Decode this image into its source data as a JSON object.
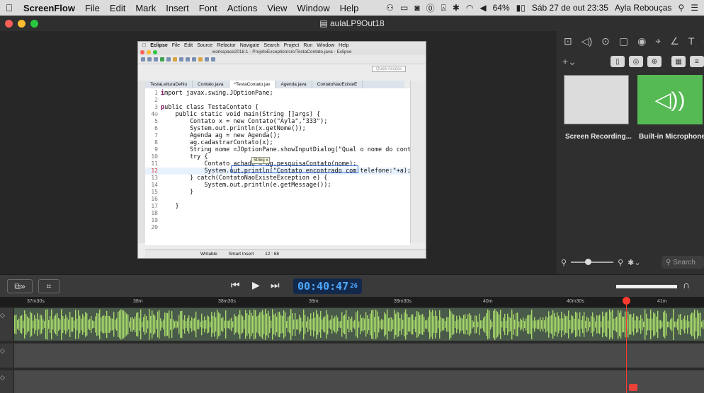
{
  "menubar": {
    "apple": "",
    "app": "ScreenFlow",
    "items": [
      "File",
      "Edit",
      "Mark",
      "Insert",
      "Font",
      "Actions",
      "View",
      "Window",
      "Help"
    ],
    "battery": "64%",
    "clock": "Sáb 27 de out  23:35",
    "user": "Ayla Rebouças"
  },
  "window": {
    "title": "aulaLP9Out18"
  },
  "eclipse": {
    "menu": [
      "Eclipse",
      "File",
      "Edit",
      "Source",
      "Refactor",
      "Navigate",
      "Search",
      "Project",
      "Run",
      "Window",
      "Help"
    ],
    "title": "workspace2018.1 - ProjetoException/src/TestaContato.java - Eclipse",
    "quick_access": "Quick Access",
    "tabs": [
      "TestaLeituraDeNu",
      "Contato.java",
      "*TestaContato.jav",
      "Agenda.java",
      "ContatoNaoExisteE"
    ],
    "active_tab": 2,
    "tooltip": "String x",
    "status": {
      "mode": "Writable",
      "insert": "Smart Insert",
      "pos": "12 : 68"
    },
    "code": [
      {
        "n": "1",
        "text": "mport javax.swing.JOptionPane;"
      },
      {
        "n": "2",
        "text": ""
      },
      {
        "n": "3",
        "text": "ublic class TestaContato {"
      },
      {
        "n": "4⊖",
        "text": "    public static void main(String []args) {"
      },
      {
        "n": "5",
        "text": "        Contato x = new Contato(\"Ayla\",\"333\");"
      },
      {
        "n": "6",
        "text": "        System.out.println(x.getNome());"
      },
      {
        "n": "7",
        "text": "        Agenda ag = new Agenda();"
      },
      {
        "n": "8",
        "text": "        ag.cadastrarContato(x);"
      },
      {
        "n": "9",
        "text": "        String nome =JOptionPane.showInputDialog(\"Qual o nome do contat"
      },
      {
        "n": "10",
        "text": "        try {"
      },
      {
        "n": "11",
        "text": "            Contato achado = ag.pesquisaContato(nome);"
      },
      {
        "n": "12",
        "text": "            System.out.println(\"Contato encontrado com telefone:\"+a);"
      },
      {
        "n": "13",
        "text": "        } catch(ContatoNaoExisteException e) {"
      },
      {
        "n": "14",
        "text": "            System.out.println(e.getMessage());"
      },
      {
        "n": "15",
        "text": "        }"
      },
      {
        "n": "16",
        "text": ""
      },
      {
        "n": "17",
        "text": "    }"
      },
      {
        "n": "18",
        "text": ""
      },
      {
        "n": "19",
        "text": ""
      },
      {
        "n": "20",
        "text": ""
      }
    ]
  },
  "media": {
    "item1": "Screen Recording...",
    "item2": "Built-in Microphone",
    "search_placeholder": "Search"
  },
  "transport": {
    "timecode": "00:40:47",
    "frames": "26"
  },
  "ruler": [
    "37m30s",
    "38m",
    "38m30s",
    "39m",
    "39m30s",
    "40m",
    "40m30s",
    "41m"
  ],
  "colors": {
    "accent": "#4ea8ff",
    "playhead": "#ff3b30",
    "media_green": "#55b954",
    "waveform": "#a6d96a"
  }
}
